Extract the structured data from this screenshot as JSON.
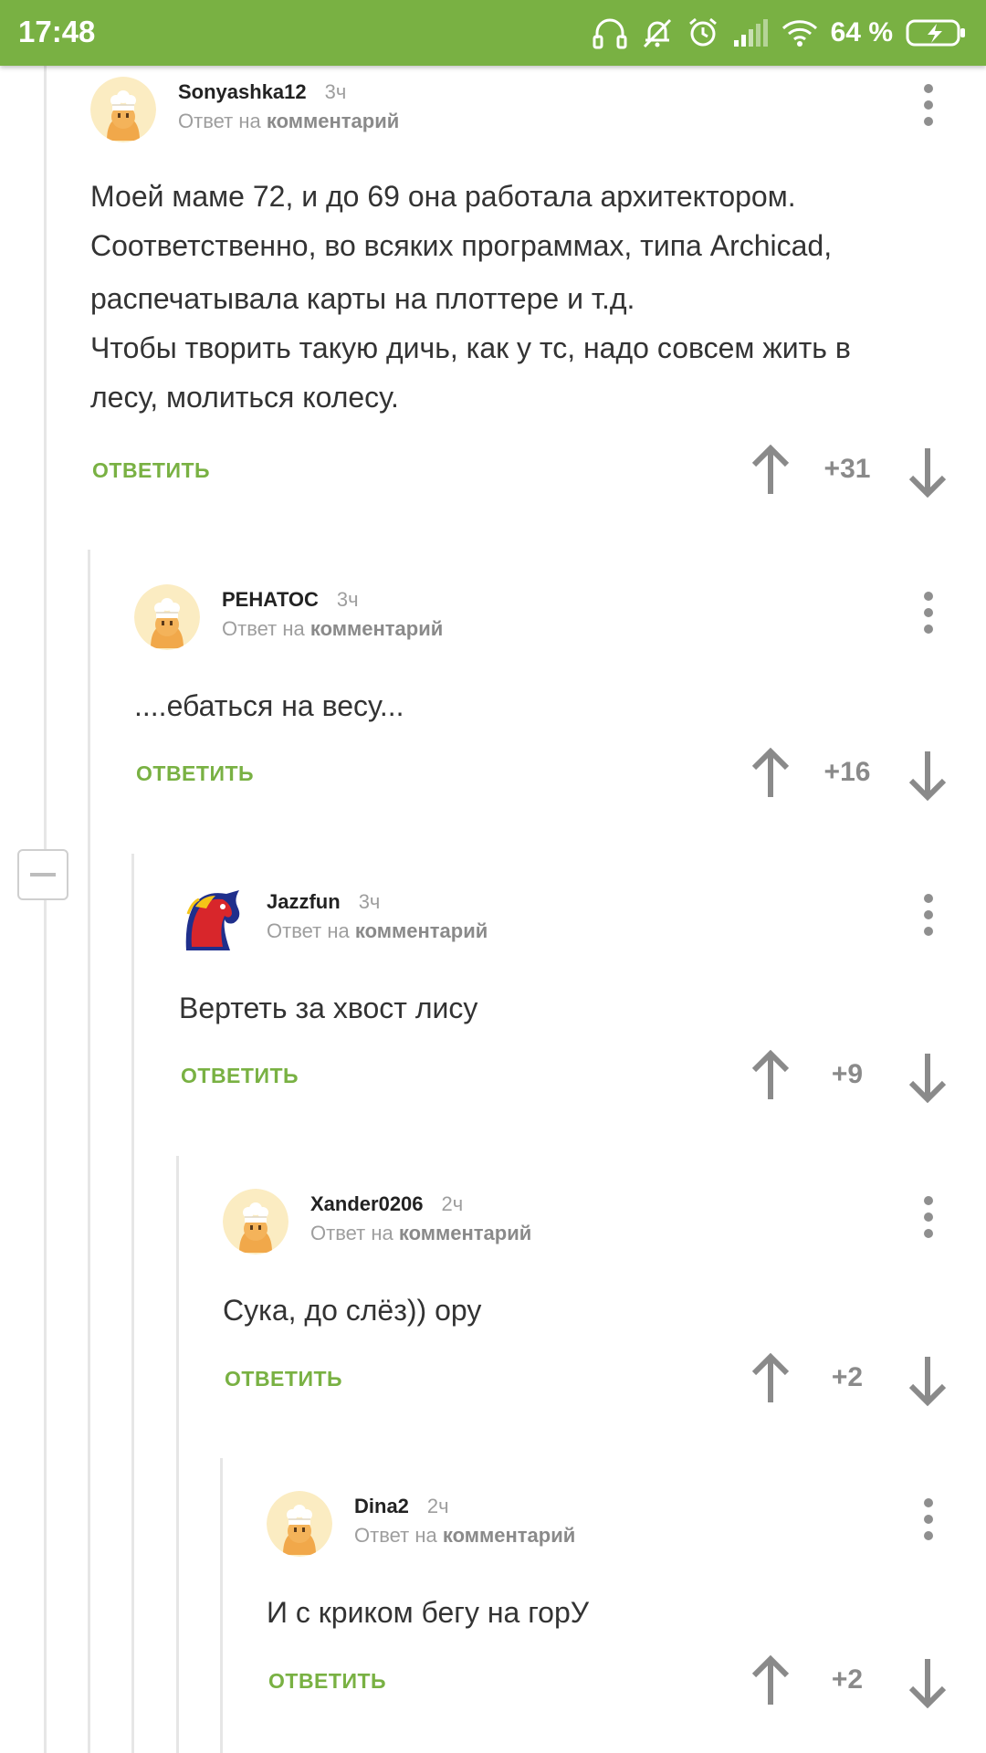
{
  "status_bar": {
    "time": "17:48",
    "battery": "64 %",
    "icons": [
      "headphones-icon",
      "muted-bell-icon",
      "alarm-icon",
      "signal-icon",
      "wifi-icon",
      "battery-charging-icon"
    ]
  },
  "comments": [
    {
      "author": "Sonyashka12",
      "time": "3ч",
      "reply_prefix": "Ответ на",
      "reply_link": "комментарий",
      "lines": [
        "Моей маме 72, и до 69 она работала архитектором.",
        "Соответственно, во всяких программах, типа Archicad,",
        "распечатывала карты на плоттере и т.д.",
        "Чтобы творить такую дичь, как у тс, надо совсем жить в",
        "лесу, молиться колесу."
      ],
      "reply_label": "ОТВЕТИТЬ",
      "score": "+31"
    },
    {
      "author": "РЕНАТОС",
      "time": "3ч",
      "reply_prefix": "Ответ на",
      "reply_link": "комментарий",
      "lines": [
        "....ебаться на весу..."
      ],
      "reply_label": "ОТВЕТИТЬ",
      "score": "+16"
    },
    {
      "author": "Jazzfun",
      "time": "3ч",
      "reply_prefix": "Ответ на",
      "reply_link": "комментарий",
      "lines": [
        "Вертеть за хвост лису"
      ],
      "reply_label": "ОТВЕТИТЬ",
      "score": "+9"
    },
    {
      "author": "Xander0206",
      "time": "2ч",
      "reply_prefix": "Ответ на",
      "reply_link": "комментарий",
      "lines": [
        "Сука, до слёз)) ору"
      ],
      "reply_label": "ОТВЕТИТЬ",
      "score": "+2"
    },
    {
      "author": "Dina2",
      "time": "2ч",
      "reply_prefix": "Ответ на",
      "reply_link": "комментарий",
      "lines": [
        "И с криком бегу на горУ"
      ],
      "reply_label": "ОТВЕТИТЬ",
      "score": "+2"
    }
  ],
  "colors": {
    "status_bar": "#79b143",
    "accent": "#79b143",
    "muted_text": "#9e9e9e",
    "thread_line": "#e6e6e6"
  }
}
